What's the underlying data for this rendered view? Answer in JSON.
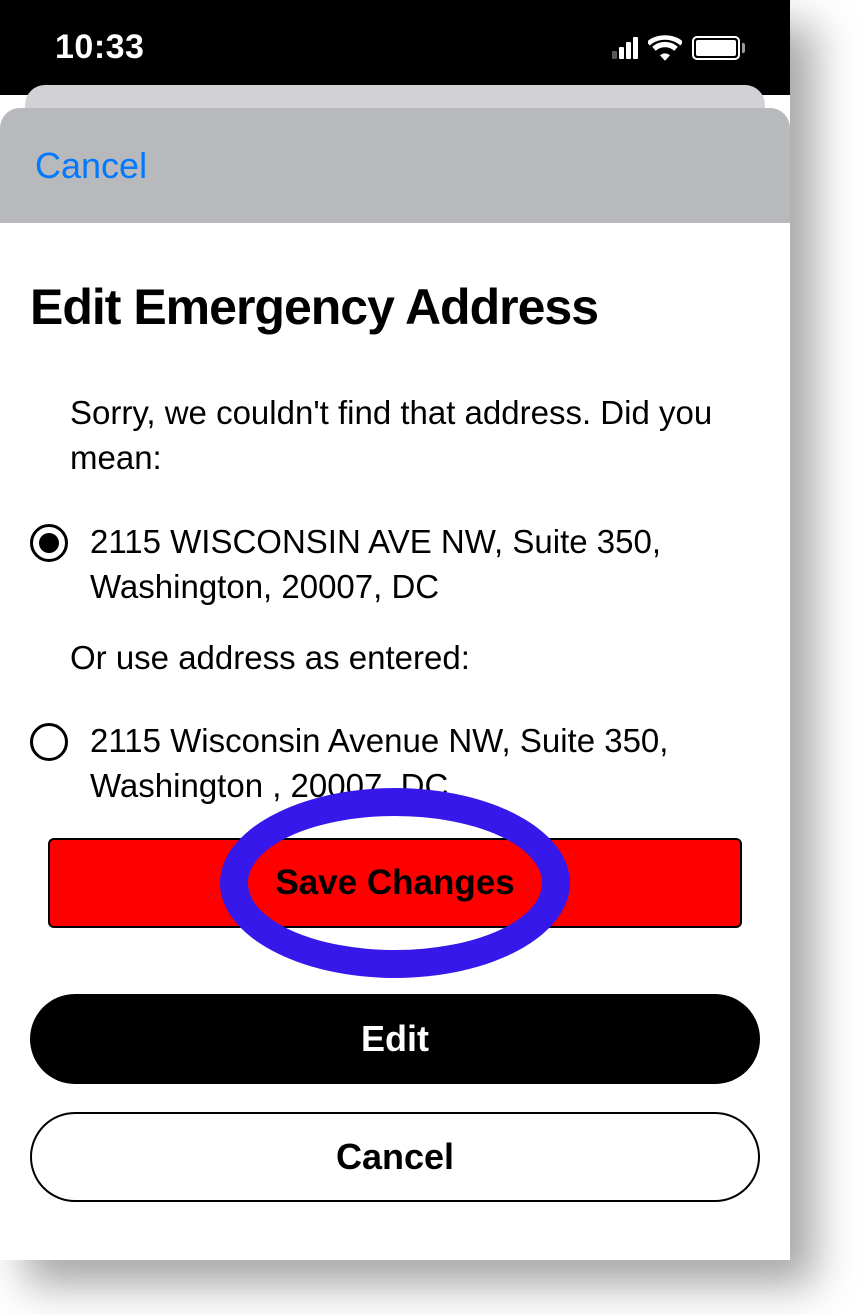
{
  "status_bar": {
    "time": "10:33"
  },
  "modal_header": {
    "cancel_label": "Cancel"
  },
  "page": {
    "title": "Edit Emergency Address",
    "prompt": "Sorry, we couldn't find that address. Did you mean:",
    "divider": "Or use address as entered:"
  },
  "options": {
    "suggested": {
      "selected": true,
      "label": "2115 WISCONSIN AVE NW, Suite 350, Washington, 20007, DC"
    },
    "entered": {
      "selected": false,
      "label": "2115 Wisconsin Avenue NW, Suite 350, Washington , 20007, DC"
    }
  },
  "buttons": {
    "save": "Save Changes",
    "edit": "Edit",
    "cancel": "Cancel"
  }
}
